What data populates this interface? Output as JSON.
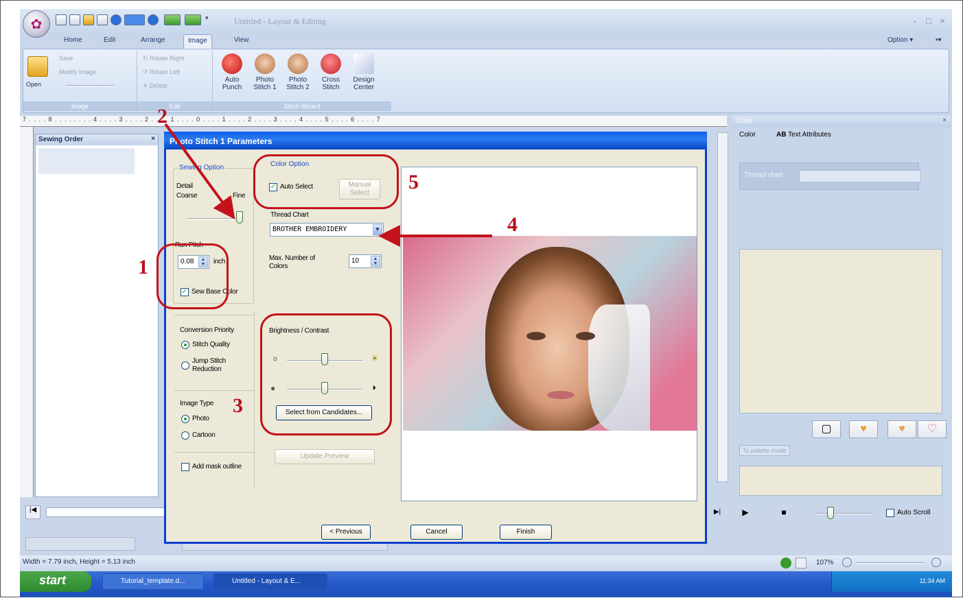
{
  "window": {
    "title": "Untitled - Layout & Editing",
    "option_label": "Option",
    "minimize": "-",
    "restore": "□",
    "close": "×"
  },
  "tabs": [
    "Home",
    "Edit",
    "Arrange",
    "Image",
    "View"
  ],
  "ribbon": {
    "image_group": {
      "label": "Image",
      "open": "Open",
      "save": "Save",
      "modify": "Modify Image"
    },
    "edit_group": {
      "label": "Edit",
      "rotate_right": "Rotate Right",
      "rotate_left": "Rotate Left",
      "delete": "Delete"
    },
    "wizard_group": {
      "label": "Stitch Wizard",
      "buttons": [
        {
          "line1": "Auto",
          "line2": "Punch"
        },
        {
          "line1": "Photo",
          "line2": "Stitch 1"
        },
        {
          "line1": "Photo",
          "line2": "Stitch 2"
        },
        {
          "line1": "Cross",
          "line2": "Stitch"
        },
        {
          "line1": "Design",
          "line2": "Center"
        }
      ]
    }
  },
  "ruler_text": "7 . . . . 8 . . . . . . . . 4 . . . . 3 . . . . 2 . . . . 1 . . . . 0 . . . . 1 . . . . 2 . . . . 3 . . . . 4 . . . . 5 . . . . 6 . . . . 7",
  "sewing_order": {
    "title": "Sewing Order",
    "close": "×"
  },
  "color_panel": {
    "title": "Color",
    "tab_color": "Color",
    "tab_text": "Text Attributes",
    "thread_chart_label": "Thread chart",
    "palette_btn": "To palette mode"
  },
  "playback": {
    "auto_scroll": "Auto Scroll"
  },
  "status": {
    "text": "Width = 7.79 inch, Height = 5.13 inch",
    "zoom": "107%"
  },
  "taskbar": {
    "start": "start",
    "tasks": [
      "Tutorial_template.d...",
      "Untitled - Layout & E..."
    ],
    "clock": "11:34 AM"
  },
  "dialog": {
    "title": "Photo Stitch 1 Parameters",
    "sewing_option": {
      "label": "Sewing Option",
      "detail": "Detail",
      "coarse": "Coarse",
      "fine": "Fine",
      "detail_level": 0.95,
      "run_pitch_label": "Run Pitch",
      "run_pitch_value": "0.08",
      "unit": "inch",
      "sew_base_color": "Sew Base Color"
    },
    "conversion": {
      "label": "Conversion Priority",
      "stitch_quality": "Stitch Quality",
      "jump_stitch": "Jump Stitch Reduction"
    },
    "image_type": {
      "label": "Image Type",
      "photo": "Photo",
      "cartoon": "Cartoon"
    },
    "add_mask": "Add mask outline",
    "color_option": {
      "label": "Color Option",
      "auto_select": "Auto Select",
      "manual_select": "Manual Select",
      "thread_chart_label": "Thread Chart",
      "thread_chart_value": "BROTHER EMBROIDERY",
      "max_colors_label": "Max. Number of Colors",
      "max_colors_value": "10"
    },
    "brightness": {
      "label": "Brightness / Contrast",
      "select_candidates": "Select from Candidates...",
      "brightness_level": 0.5,
      "contrast_level": 0.5
    },
    "update_preview": "Update Preview",
    "previous": "< Previous",
    "cancel": "Cancel",
    "finish": "Finish"
  },
  "annotations": [
    "1",
    "2",
    "3",
    "4",
    "5"
  ],
  "colors": {
    "annotation_red": "#c3121b",
    "title_blue": "#0b5ce8"
  }
}
